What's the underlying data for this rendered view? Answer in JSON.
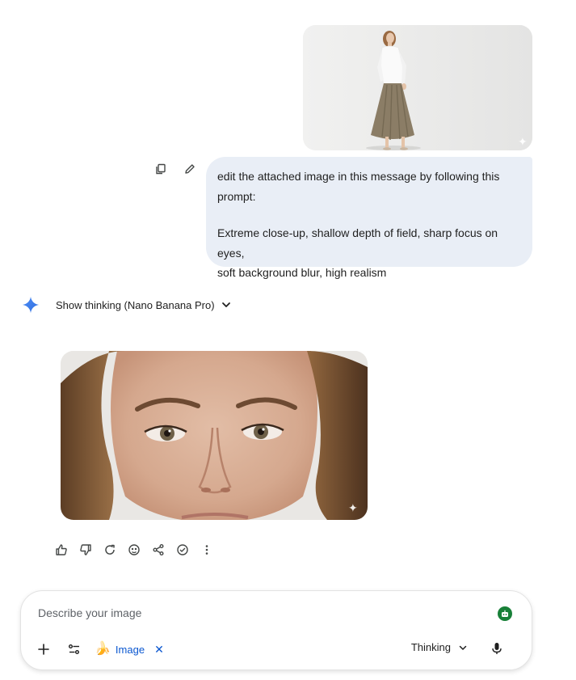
{
  "conversation": {
    "user_message": {
      "line1": "edit the attached image in this message by following this",
      "line2": "prompt:",
      "line3": "Extreme close-up, shallow depth of field, sharp focus on eyes,",
      "line4": "soft background blur, high realism"
    },
    "model_response": {
      "thinking_label": "Show thinking (Nano Banana Pro)"
    }
  },
  "composer": {
    "placeholder": "Describe your image",
    "tool_chip_label": "Image",
    "mode_label": "Thinking"
  },
  "colors": {
    "bubble_bg": "#e9eef6",
    "accent_blue": "#0b57d0",
    "badge_green": "#188038",
    "gemini_blue": "#4285f4"
  },
  "icons": {
    "user_actions": [
      "copy-icon",
      "edit-pencil-icon"
    ],
    "response_actions": [
      "thumbs-up-icon",
      "thumbs-down-icon",
      "regenerate-icon",
      "modify-icon",
      "share-icon",
      "double-check-icon",
      "more-vert-icon"
    ],
    "composer": [
      "plus-icon",
      "tools-icon",
      "banana-icon",
      "close-icon",
      "chevron-down-icon",
      "mic-icon"
    ]
  }
}
